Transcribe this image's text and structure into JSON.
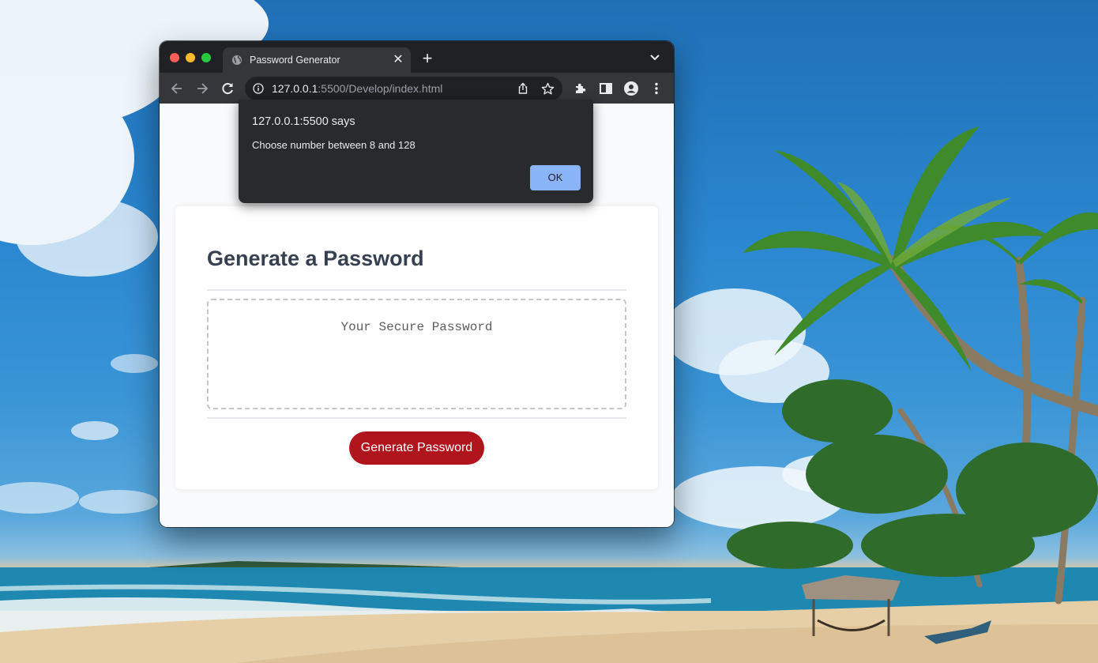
{
  "browser": {
    "tab_title": "Password Generator",
    "tab_icon": "globe-icon",
    "url_host": "127.0.0.1",
    "url_rest": ":5500/Develop/index.html",
    "colors": {
      "frame": "#202124",
      "toolbar": "#35363a",
      "omnibox": "#202124"
    }
  },
  "page": {
    "title": "Generate a Password",
    "password_placeholder": "Your Secure Password",
    "generate_button": "Generate Password",
    "colors": {
      "title": "#364050",
      "button": "#b0151d",
      "background": "#f9fafb"
    }
  },
  "alert": {
    "title": "127.0.0.1:5500 says",
    "message": "Choose number between 8 and 128",
    "ok_label": "OK",
    "colors": {
      "background": "#292a2d",
      "ok_button": "#8ab4f8"
    }
  },
  "icons": [
    "back-icon",
    "forward-icon",
    "reload-icon",
    "info-icon",
    "share-icon",
    "star-icon",
    "extensions-icon",
    "side-panel-icon",
    "profile-icon",
    "menu-icon",
    "new-tab-icon",
    "tab-close-icon",
    "tab-search-icon"
  ]
}
